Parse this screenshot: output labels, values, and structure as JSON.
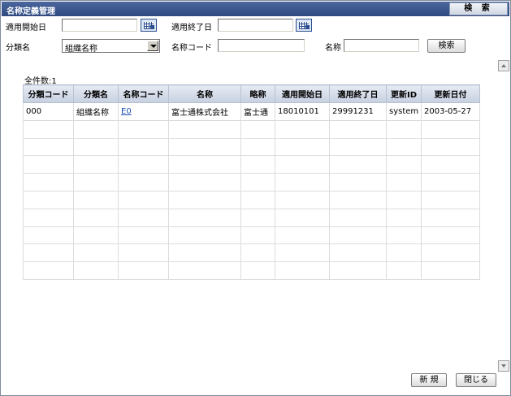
{
  "window": {
    "title": "名称定義管理",
    "tab_label": "検 索"
  },
  "search": {
    "start_date_label": "適用開始日",
    "start_date_value": "",
    "end_date_label": "適用終了日",
    "end_date_value": "",
    "category_label": "分類名",
    "category_selected": "組織名称",
    "name_code_label": "名称コード",
    "name_code_value": "",
    "name_label": "名称",
    "name_value": "",
    "search_button": "検索"
  },
  "results": {
    "count_text": "全件数:1",
    "columns": [
      "分類コード",
      "分類名",
      "名称コード",
      "名称",
      "略称",
      "適用開始日",
      "適用終了日",
      "更新ID",
      "更新日付"
    ],
    "rows": [
      [
        "000",
        "組織名称",
        "E0",
        "富士通株式会社",
        "富士通",
        "18010101",
        "29991231",
        "system",
        "2003-05-27"
      ]
    ],
    "empty_rows": 9
  },
  "footer": {
    "new_button": "新 規",
    "close_button": "閉じる"
  },
  "colors": {
    "titlebar": "#2f4a80",
    "header": "#c7d0e0",
    "link": "#1f4fb0"
  }
}
